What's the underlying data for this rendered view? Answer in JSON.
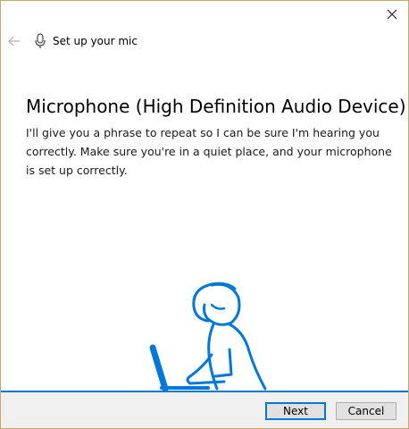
{
  "window": {
    "header_title": "Set up your mic",
    "icons": {
      "close": "close-icon",
      "back": "back-arrow-icon",
      "mic": "microphone-icon"
    }
  },
  "main": {
    "title": "Microphone (High Definition Audio Device)",
    "description": "I'll give you a phrase to repeat so I can be sure I'm hearing you correctly. Make sure you're in a quiet place, and your microphone is set up correctly."
  },
  "footer": {
    "next_label": "Next",
    "cancel_label": "Cancel"
  },
  "colors": {
    "accent": "#0078d7",
    "window_border": "#c8a868",
    "footer_bg": "#f0f0f0"
  }
}
